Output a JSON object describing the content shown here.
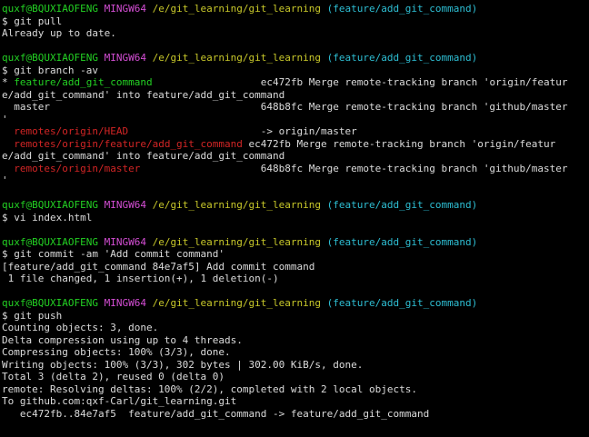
{
  "colors": {
    "background": "#000000",
    "default": "#dcdcdc",
    "user": "#23d123",
    "env": "#d44ed4",
    "path": "#c8c82a",
    "branch": "#2ebfd4",
    "current_branch": "#23d123",
    "remote_branch": "#d22525"
  },
  "lines": [
    {
      "segments": [
        {
          "text": "quxf@BQUXIAOFENG",
          "color": "user"
        },
        {
          "text": " "
        },
        {
          "text": "MINGW64",
          "color": "env"
        },
        {
          "text": " "
        },
        {
          "text": "/e/git_learning/git_learning",
          "color": "path"
        },
        {
          "text": " "
        },
        {
          "text": "(feature/add_git_command)",
          "color": "branch"
        }
      ]
    },
    {
      "segments": [
        {
          "text": "$ git pull"
        }
      ]
    },
    {
      "segments": [
        {
          "text": "Already up to date."
        }
      ]
    },
    {
      "segments": []
    },
    {
      "segments": [
        {
          "text": "quxf@BQUXIAOFENG",
          "color": "user"
        },
        {
          "text": " "
        },
        {
          "text": "MINGW64",
          "color": "env"
        },
        {
          "text": " "
        },
        {
          "text": "/e/git_learning/git_learning",
          "color": "path"
        },
        {
          "text": " "
        },
        {
          "text": "(feature/add_git_command)",
          "color": "branch"
        }
      ]
    },
    {
      "segments": [
        {
          "text": "$ git branch -av"
        }
      ]
    },
    {
      "segments": [
        {
          "text": "* "
        },
        {
          "text": "feature/add_git_command",
          "color": "current_branch"
        },
        {
          "text": "                  ec472fb Merge remote-tracking branch 'origin/featur"
        }
      ]
    },
    {
      "segments": [
        {
          "text": "e/add_git_command' into feature/add_git_command"
        }
      ]
    },
    {
      "segments": [
        {
          "text": "  master                                   648b8fc Merge remote-tracking branch 'github/master"
        }
      ]
    },
    {
      "segments": [
        {
          "text": "'"
        }
      ]
    },
    {
      "segments": [
        {
          "text": "  "
        },
        {
          "text": "remotes/origin/HEAD",
          "color": "remote_branch"
        },
        {
          "text": "                      -> origin/master"
        }
      ]
    },
    {
      "segments": [
        {
          "text": "  "
        },
        {
          "text": "remotes/origin/feature/add_git_command",
          "color": "remote_branch"
        },
        {
          "text": " ec472fb Merge remote-tracking branch 'origin/featur"
        }
      ]
    },
    {
      "segments": [
        {
          "text": "e/add_git_command' into feature/add_git_command"
        }
      ]
    },
    {
      "segments": [
        {
          "text": "  "
        },
        {
          "text": "remotes/origin/master",
          "color": "remote_branch"
        },
        {
          "text": "                    648b8fc Merge remote-tracking branch 'github/master"
        }
      ]
    },
    {
      "segments": [
        {
          "text": "'"
        }
      ]
    },
    {
      "segments": []
    },
    {
      "segments": [
        {
          "text": "quxf@BQUXIAOFENG",
          "color": "user"
        },
        {
          "text": " "
        },
        {
          "text": "MINGW64",
          "color": "env"
        },
        {
          "text": " "
        },
        {
          "text": "/e/git_learning/git_learning",
          "color": "path"
        },
        {
          "text": " "
        },
        {
          "text": "(feature/add_git_command)",
          "color": "branch"
        }
      ]
    },
    {
      "segments": [
        {
          "text": "$ vi index.html"
        }
      ]
    },
    {
      "segments": []
    },
    {
      "segments": [
        {
          "text": "quxf@BQUXIAOFENG",
          "color": "user"
        },
        {
          "text": " "
        },
        {
          "text": "MINGW64",
          "color": "env"
        },
        {
          "text": " "
        },
        {
          "text": "/e/git_learning/git_learning",
          "color": "path"
        },
        {
          "text": " "
        },
        {
          "text": "(feature/add_git_command)",
          "color": "branch"
        }
      ]
    },
    {
      "segments": [
        {
          "text": "$ git commit -am 'Add commit command'"
        }
      ]
    },
    {
      "segments": [
        {
          "text": "[feature/add_git_command 84e7af5] Add commit command"
        }
      ]
    },
    {
      "segments": [
        {
          "text": " 1 file changed, 1 insertion(+), 1 deletion(-)"
        }
      ]
    },
    {
      "segments": []
    },
    {
      "segments": [
        {
          "text": "quxf@BQUXIAOFENG",
          "color": "user"
        },
        {
          "text": " "
        },
        {
          "text": "MINGW64",
          "color": "env"
        },
        {
          "text": " "
        },
        {
          "text": "/e/git_learning/git_learning",
          "color": "path"
        },
        {
          "text": " "
        },
        {
          "text": "(feature/add_git_command)",
          "color": "branch"
        }
      ]
    },
    {
      "segments": [
        {
          "text": "$ git push"
        }
      ]
    },
    {
      "segments": [
        {
          "text": "Counting objects: 3, done."
        }
      ]
    },
    {
      "segments": [
        {
          "text": "Delta compression using up to 4 threads."
        }
      ]
    },
    {
      "segments": [
        {
          "text": "Compressing objects: 100% (3/3), done."
        }
      ]
    },
    {
      "segments": [
        {
          "text": "Writing objects: 100% (3/3), 302 bytes | 302.00 KiB/s, done."
        }
      ]
    },
    {
      "segments": [
        {
          "text": "Total 3 (delta 2), reused 0 (delta 0)"
        }
      ]
    },
    {
      "segments": [
        {
          "text": "remote: Resolving deltas: 100% (2/2), completed with 2 local objects."
        }
      ]
    },
    {
      "segments": [
        {
          "text": "To github.com:qxf-Carl/git_learning.git"
        }
      ]
    },
    {
      "segments": [
        {
          "text": "   ec472fb..84e7af5  feature/add_git_command -> feature/add_git_command"
        }
      ]
    }
  ]
}
